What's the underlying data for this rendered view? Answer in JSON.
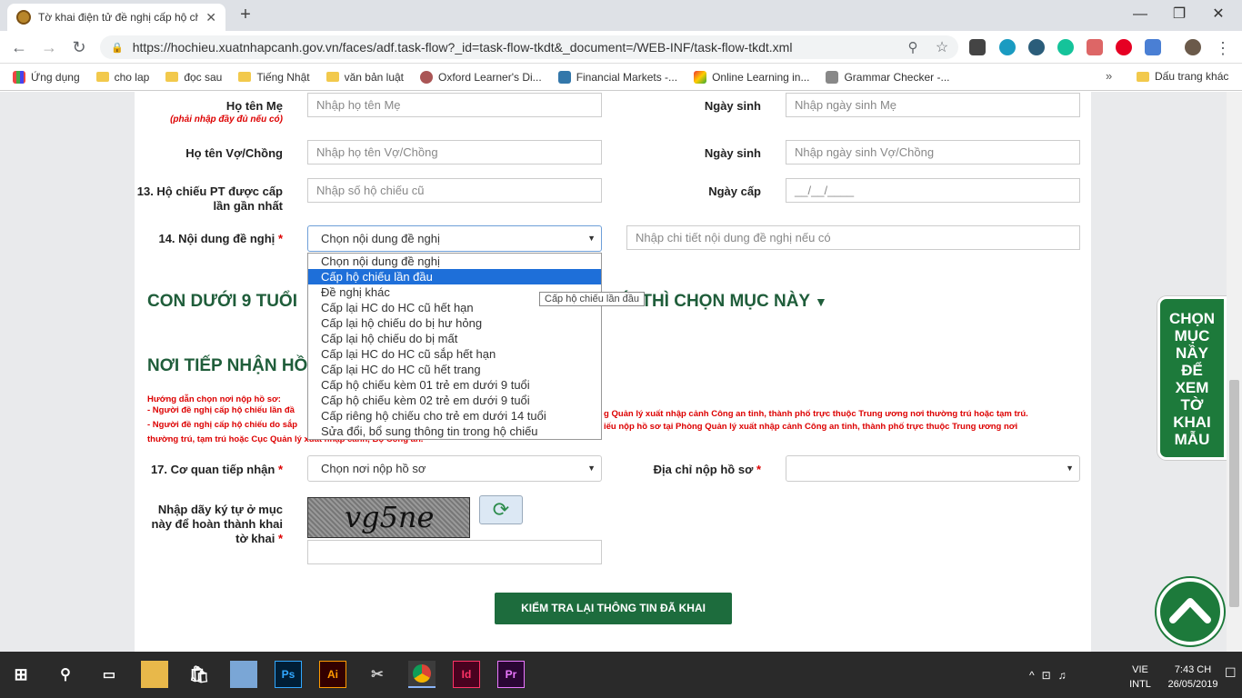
{
  "browser": {
    "tab_title": "Tờ khai điện tử đề nghị cấp hộ chi",
    "url": "https://hochieu.xuatnhapcanh.gov.vn/faces/adf.task-flow?_id=task-flow-tkdt&_document=/WEB-INF/task-flow-tkdt.xml",
    "bookmarks": [
      "Ứng dụng",
      "cho lap",
      "đọc sau",
      "Tiếng Nhật",
      "văn bản luật",
      "Oxford Learner's Di...",
      "Financial Markets -...",
      "Online Learning in...",
      "Grammar Checker -..."
    ],
    "other_bookmarks": "Dấu trang khác"
  },
  "form": {
    "mother_name_label": "Họ tên Mẹ",
    "mother_hint": "(phải nhập đầy đủ nếu có)",
    "mother_name_placeholder": "Nhập họ tên Mẹ",
    "dob_label": "Ngày sinh",
    "mother_dob_placeholder": "Nhập ngày sinh Mẹ",
    "spouse_label": "Họ tên Vợ/Chồng",
    "spouse_placeholder": "Nhập họ tên Vợ/Chồng",
    "spouse_dob_placeholder": "Nhập ngày sinh Vợ/Chồng",
    "passport_label_1": "13. Hộ chiếu PT được cấp",
    "passport_label_2": "lần gần nhất",
    "passport_placeholder": "Nhập số hộ chiếu cũ",
    "issue_date_label": "Ngày cấp",
    "issue_date_placeholder": "__/__/____",
    "request_label": "14. Nội dung đề nghị",
    "request_selected": "Chọn nội dung đề nghị",
    "request_detail_placeholder": "Nhập chi tiết nội dung đề nghị nếu có",
    "request_options": [
      "Chọn nội dung đề nghị",
      "Cấp hộ chiếu lần đầu",
      "Đề nghị khác",
      "Cấp lại HC do HC cũ hết hạn",
      "Cấp lại hộ chiếu do bị hư hỏng",
      "Cấp lại hộ chiếu do bị mất",
      "Cấp lại HC do HC cũ sắp hết hạn",
      "Cấp lại HC do HC cũ hết trang",
      "Cấp hộ chiếu kèm 01 trẻ em dưới 9 tuổi",
      "Cấp hộ chiếu kèm 02 trẻ em dưới 9 tuổi",
      "Cấp riêng hộ chiếu cho trẻ em dưới 14 tuổi",
      "Sửa đổi, bổ sung thông tin trong hộ chiếu"
    ],
    "tooltip": "Cấp hộ chiếu lần đầu",
    "children_heading_left": "CON DƯỚI 9 TUỔI",
    "children_heading_right": "ÓI THÌ CHỌN MỤC NÀY",
    "receive_heading": "NƠI TIẾP NHẬN HỒ",
    "guide_title": "Hướng dẫn chọn nơi nộp hồ sơ:",
    "guide_line1_left": "- Người đề nghị cấp hộ chiếu lần đầ",
    "guide_line1_right": "g Quản lý xuất nhập cảnh Công an tỉnh, thành phố trực thuộc Trung ương nơi thường trú hoặc tạm trú.",
    "guide_line2_left": "- Người đề nghị cấp hộ chiếu do sắp",
    "guide_line2_right": "iếu nộp hồ sơ tại Phòng Quản lý xuất nhập cảnh Công an tỉnh, thành phố trực thuộc Trung ương nơi",
    "guide_line3": "thường trú, tạm trú hoặc Cục Quản lý xuất nhập cảnh, Bộ Công an.",
    "agency_label": "17. Cơ quan tiếp nhận",
    "agency_selected": "Chọn nơi nộp hồ sơ",
    "address_label": "Địa chỉ nộp hồ sơ",
    "captcha_label_1": "Nhập dãy ký tự ở mục",
    "captcha_label_2": "này để hoàn thành khai",
    "captcha_label_3": "tờ khai",
    "captcha_text": "vg5ne",
    "check_button": "KIỂM TRA LẠI THÔNG TIN ĐÃ KHAI",
    "side_button": [
      "CHỌN",
      "MỤC",
      "NẦY",
      "ĐỂ",
      "XEM",
      "TỜ",
      "KHAI",
      "MẪU"
    ]
  },
  "taskbar": {
    "lang_1": "VIE",
    "lang_2": "INTL",
    "time": "7:43 CH",
    "date": "26/05/2019"
  },
  "colors": {
    "brand_green": "#1d7a3b",
    "selection_blue": "#1e6fd9",
    "required_red": "#d00"
  }
}
